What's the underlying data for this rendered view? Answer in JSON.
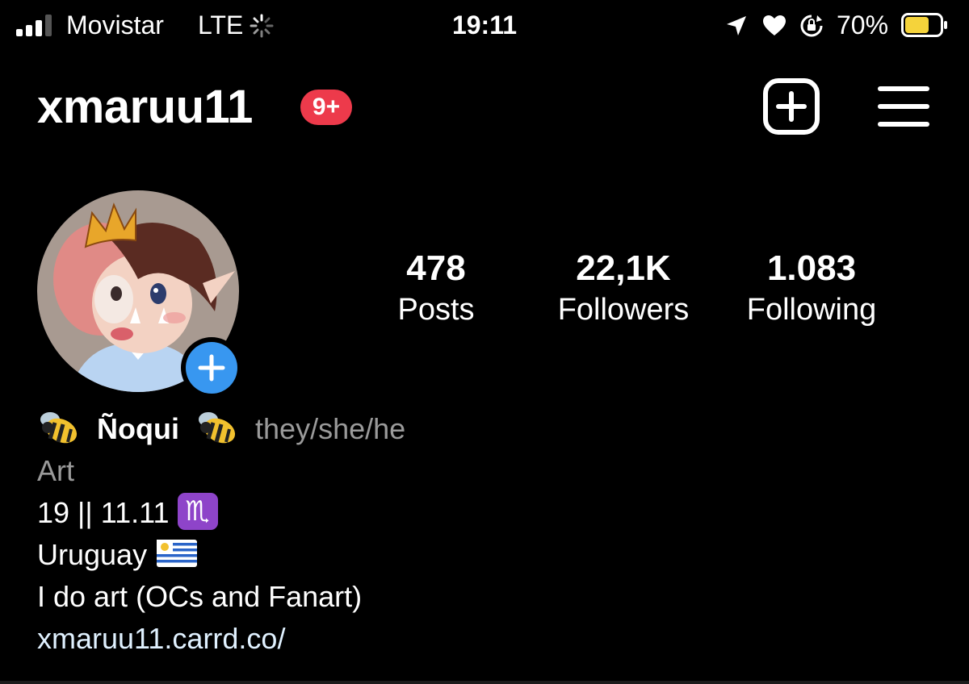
{
  "status_bar": {
    "carrier": "Movistar",
    "network": "LTE",
    "time": "19:11",
    "battery_percent": "70%",
    "battery_level": 0.7,
    "battery_color": "#f5d33b",
    "icons": [
      "signal-icon",
      "loading-spinner-icon",
      "location-arrow-icon",
      "heart-icon",
      "orientation-lock-icon",
      "battery-icon"
    ]
  },
  "header": {
    "username": "xmaruu11",
    "notification_badge": "9+",
    "badge_color": "#ed3a4b",
    "icons": [
      "add-post-icon",
      "hamburger-menu-icon"
    ]
  },
  "profile": {
    "stats": {
      "posts_value": "478",
      "posts_label": "Posts",
      "followers_value": "22,1K",
      "followers_label": "Followers",
      "following_value": "1.083",
      "following_label": "Following"
    },
    "accent_color": "#3897f0"
  },
  "bio": {
    "name": "Ñoqui",
    "pronouns": "they/she/he",
    "category": "Art",
    "line1": "19 || 11.11",
    "scorpio_glyph": "♏",
    "line2": "Uruguay",
    "line3": "I do art (OCs and Fanart)",
    "link": "xmaruu11.carrd.co/",
    "emoji": [
      "bee-emoji",
      "scorpio-emoji",
      "uruguay-flag-emoji"
    ]
  }
}
